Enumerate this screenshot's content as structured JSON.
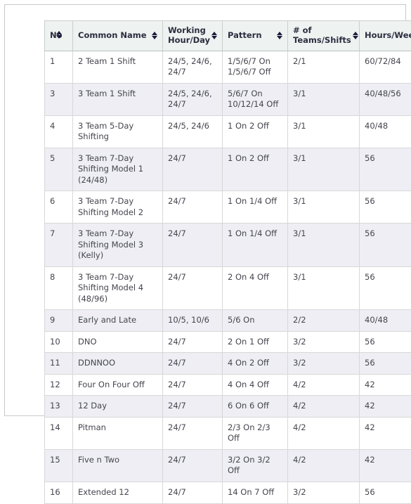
{
  "table": {
    "columns": [
      {
        "key": "no",
        "label": "No",
        "sortable": true,
        "sort_icon": "sort-updown-icon"
      },
      {
        "key": "name",
        "label": "Common Name",
        "sortable": true,
        "sort_icon": "sort-updown-icon"
      },
      {
        "key": "hours",
        "label": "Working Hour/Day",
        "sortable": true,
        "sort_icon": "sort-updown-icon"
      },
      {
        "key": "pattern",
        "label": "Pattern",
        "sortable": true,
        "sort_icon": "sort-updown-icon"
      },
      {
        "key": "teams",
        "label": "# of Teams/Shifts",
        "sortable": true,
        "sort_icon": "sort-updown-icon"
      },
      {
        "key": "week",
        "label": "Hours/Week",
        "sortable": true,
        "sort_icon": "sort-updown-icon"
      }
    ],
    "rows": [
      {
        "no": "1",
        "name": "2 Team 1 Shift",
        "hours": "24/5, 24/6, 24/7",
        "pattern": "1/5/6/7 On 1/5/6/7 Off",
        "teams": "2/1",
        "week": "60/72/84"
      },
      {
        "no": "3",
        "name": "3 Team 1 Shift",
        "hours": "24/5, 24/6, 24/7",
        "pattern": "5/6/7 On 10/12/14 Off",
        "teams": "3/1",
        "week": "40/48/56"
      },
      {
        "no": "4",
        "name": "3 Team 5-Day Shifting",
        "hours": "24/5, 24/6",
        "pattern": "1 On 2 Off",
        "teams": "3/1",
        "week": "40/48"
      },
      {
        "no": "5",
        "name": "3 Team 7-Day Shifting Model 1 (24/48)",
        "hours": "24/7",
        "pattern": "1 On 2 Off",
        "teams": "3/1",
        "week": "56"
      },
      {
        "no": "6",
        "name": "3 Team 7-Day Shifting Model 2",
        "hours": "24/7",
        "pattern": "1 On 1/4 Off",
        "teams": "3/1",
        "week": "56"
      },
      {
        "no": "7",
        "name": "3 Team 7-Day Shifting Model 3 (Kelly)",
        "hours": "24/7",
        "pattern": "1 On 1/4 Off",
        "teams": "3/1",
        "week": "56"
      },
      {
        "no": "8",
        "name": "3 Team 7-Day Shifting Model 4 (48/96)",
        "hours": "24/7",
        "pattern": "2 On 4 Off",
        "teams": "3/1",
        "week": "56"
      },
      {
        "no": "9",
        "name": "Early and Late",
        "hours": "10/5, 10/6",
        "pattern": "5/6 On",
        "teams": "2/2",
        "week": "40/48"
      },
      {
        "no": "10",
        "name": "DNO",
        "hours": "24/7",
        "pattern": "2 On 1 Off",
        "teams": "3/2",
        "week": "56"
      },
      {
        "no": "11",
        "name": "DDNNOO",
        "hours": "24/7",
        "pattern": "4 On 2 Off",
        "teams": "3/2",
        "week": "56"
      },
      {
        "no": "12",
        "name": "Four On Four Off",
        "hours": "24/7",
        "pattern": "4 On 4 Off",
        "teams": "4/2",
        "week": "42"
      },
      {
        "no": "13",
        "name": "12 Day",
        "hours": "24/7",
        "pattern": "6 On 6 Off",
        "teams": "4/2",
        "week": "42"
      },
      {
        "no": "14",
        "name": "Pitman",
        "hours": "24/7",
        "pattern": "2/3 On 2/3 Off",
        "teams": "4/2",
        "week": "42"
      },
      {
        "no": "15",
        "name": "Five n Two",
        "hours": "24/7",
        "pattern": "3/2 On 3/2 Off",
        "teams": "4/2",
        "week": "42"
      },
      {
        "no": "16",
        "name": "Extended 12",
        "hours": "24/7",
        "pattern": "14 On 7 Off",
        "teams": "3/2",
        "week": "56"
      }
    ]
  },
  "colors": {
    "header_bg": "#eef2f1",
    "alt_row_bg": "#eeeef4",
    "row_bg": "#ffffff",
    "text": "#45454f",
    "header_text": "#2d2d3f",
    "border": "#d8d8d8",
    "frame_border": "#c9c9c9"
  }
}
